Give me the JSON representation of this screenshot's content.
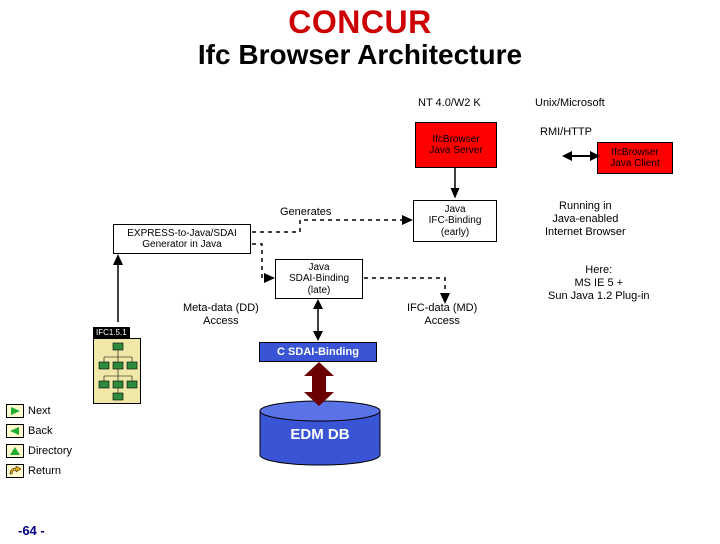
{
  "title_brand": "CONCUR",
  "title_main": "Ifc Browser Architecture",
  "labels": {
    "nt": "NT 4.0/W2 K",
    "unix": "Unix/Microsoft",
    "rmi": "RMI/HTTP",
    "generates": "Generates",
    "java_ifc_binding": "Java\nIFC-Binding\n(early)",
    "java_server": "IfcBrowser\nJava Server",
    "java_client": "IfcBrowser\nJava Client",
    "sdai_binding": "Java\nSDAI-Binding\n(late)",
    "express_gen": "EXPRESS-to-Java/SDAI\nGenerator in Java",
    "meta_access": "Meta-data (DD)\nAccess",
    "ifc_access": "IFC-data (MD)\nAccess",
    "c_sdai": "C SDAI-Binding",
    "edm_db": "EDM DB",
    "ifc_version": "IFC1.5.1",
    "running_note": "Running in\nJava-enabled\nInternet Browser",
    "here_note": "Here:\nMS IE 5 +\nSun Java 1.2 Plug-in"
  },
  "nav": {
    "next": "Next",
    "back": "Back",
    "directory": "Directory",
    "return": "Return"
  },
  "slide_number": "-64 -"
}
